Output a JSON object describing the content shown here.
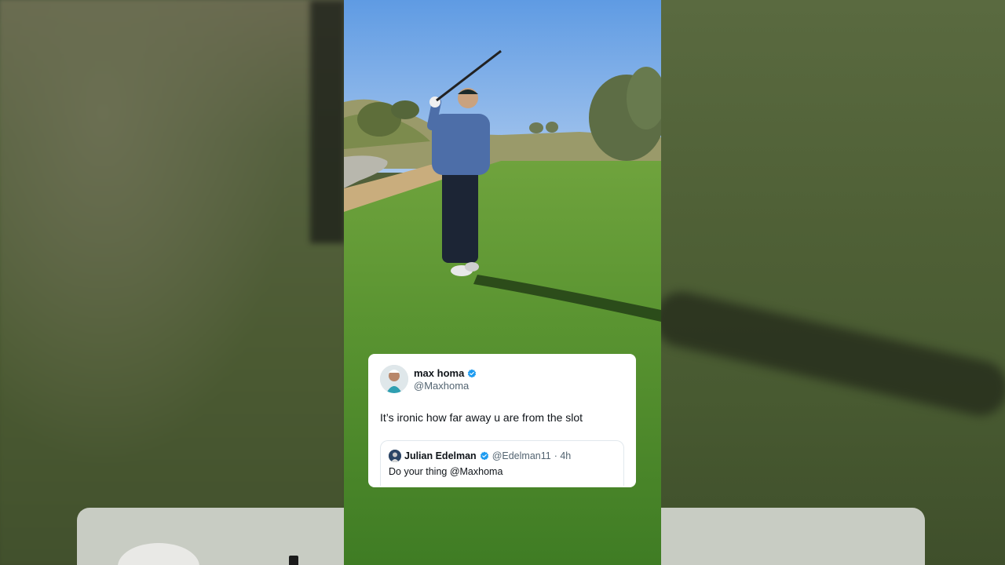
{
  "tweet": {
    "author_name": "max homa",
    "author_handle": "@Maxhoma",
    "text": "It’s ironic how far away u are from the slot",
    "quoted": {
      "author_name": "Julian Edelman",
      "author_handle": "@Edelman11",
      "time": "· 4h",
      "text": "Do your thing  @Maxhoma"
    }
  },
  "icons": {
    "verified": "verified-badge-icon",
    "avatar_main": "avatar",
    "avatar_quoted": "avatar"
  },
  "colors": {
    "verified_blue": "#1d9bf0",
    "sky": "#6ea4e0",
    "grass": "#4f8a2d"
  }
}
